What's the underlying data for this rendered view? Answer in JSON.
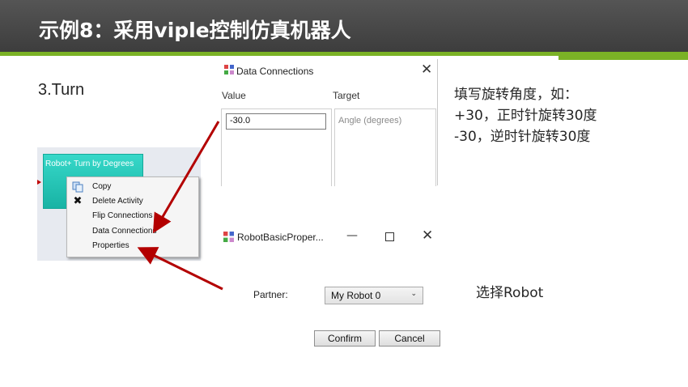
{
  "header": {
    "title": "示例8：采用viple控制仿真机器人"
  },
  "step_label": "3.Turn",
  "activity": {
    "label": "Robot+ Turn by Degrees"
  },
  "context_menu": {
    "items": [
      {
        "label": "Copy",
        "icon": "copy-icon"
      },
      {
        "label": "Delete Activity",
        "icon": "close-x-icon"
      },
      {
        "label": "Flip Connections",
        "icon": ""
      },
      {
        "label": "Data Connections",
        "icon": ""
      },
      {
        "label": "Properties",
        "icon": ""
      }
    ]
  },
  "data_connections": {
    "title": "Data Connections",
    "close_glyph": "✕",
    "col_value": "Value",
    "col_target": "Target",
    "value": "-30.0",
    "target_placeholder": "Angle (degrees)"
  },
  "note_angle": {
    "line1": "填写旋转角度，如：",
    "line2": "+30，正时针旋转30度",
    "line3": "-30，逆时针旋转30度"
  },
  "robot_properties": {
    "title": "RobotBasicProper...",
    "minimize_glyph": "—",
    "close_glyph": "✕",
    "partner_label": "Partner:",
    "partner_value": "My Robot 0",
    "confirm": "Confirm",
    "cancel": "Cancel"
  },
  "note_robot": "选择Robot",
  "colors": {
    "header_bg": "#3d3d3d",
    "accent_green": "#7bb226",
    "activity_teal": "#1fc2b2",
    "arrow_red": "#b30000"
  }
}
